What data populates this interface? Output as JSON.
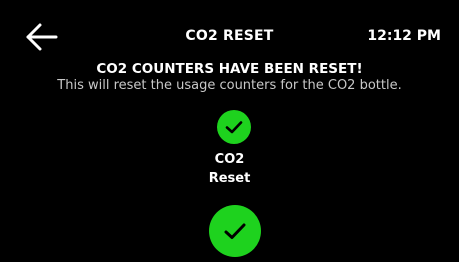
{
  "header": {
    "back_icon": "arrow-left-icon",
    "title": "CO2 RESET",
    "time": "12:12 PM"
  },
  "message": {
    "headline": "CO2 COUNTERS HAVE BEEN RESET!",
    "description": "This will reset the usage counters for the CO2 bottle."
  },
  "status": {
    "icon": "check-icon",
    "label_line1": "CO2",
    "label_line2": "Reset"
  },
  "confirm": {
    "icon": "check-icon"
  },
  "colors": {
    "background": "#000000",
    "accent_green": "#1ed21e",
    "text": "#ffffff",
    "subtext": "#c8c8c8"
  }
}
